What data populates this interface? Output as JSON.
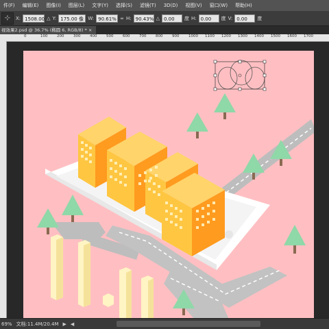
{
  "menu": [
    "件(F)",
    "编辑(E)",
    "图像(I)",
    "图层(L)",
    "文字(Y)",
    "选择(S)",
    "滤镜(T)",
    "3D(D)",
    "视图(V)",
    "窗口(W)",
    "帮助(H)"
  ],
  "options": {
    "x_label": "X:",
    "x_value": "1508.00 像",
    "y_label": "Y:",
    "y_value": "175.00 像",
    "w_label": "W:",
    "w_value": "90.61%",
    "link_glyph": "∞",
    "h_label": "H:",
    "h_value": "90.43%",
    "angle_value": "0.00",
    "degree_unit": "度",
    "hskew_label": "H:",
    "hskew_value": "0.00",
    "vskew_label": "V:",
    "vskew_value": "0.00"
  },
  "doc_tab": "视效果2.psd @ 36.7% (椭圆 6, RGB/8) * ×",
  "ruler_numbers": [
    "0",
    "100",
    "200",
    "300",
    "400",
    "500",
    "600",
    "700",
    "800",
    "900",
    "1000",
    "1100",
    "1200",
    "1300",
    "1400",
    "1500",
    "1600",
    "1700"
  ],
  "status": {
    "zoom": "69%",
    "doc_info": "文档:11.4M/20.4M"
  },
  "colors": {
    "canvas_bg": "#ffbfc2",
    "building_light": "#ffc642",
    "building_dark": "#ff9b1f",
    "tree": "#8fd8a8",
    "road": "#bdbdbd",
    "phone": "#ffffff",
    "pillar": "#fff4c4"
  }
}
